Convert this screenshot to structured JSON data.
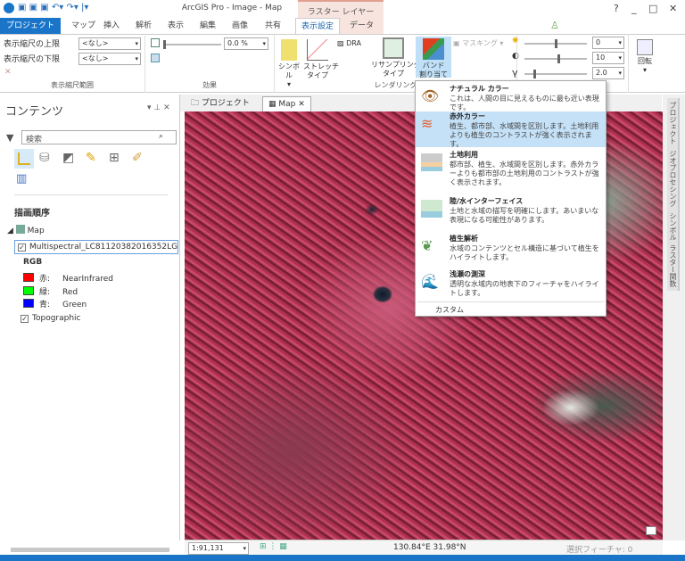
{
  "window": {
    "title": "ArcGIS Pro - Image - Map",
    "contextual_tab": "ラスター レイヤー",
    "help": "?",
    "minimize": "_",
    "maximize": "□",
    "close": "✕"
  },
  "tabs": [
    {
      "label": "プロジェクト"
    },
    {
      "label": "マップ"
    },
    {
      "label": "挿入"
    },
    {
      "label": "解析"
    },
    {
      "label": "表示"
    },
    {
      "label": "編集"
    },
    {
      "label": "画像"
    },
    {
      "label": "共有"
    },
    {
      "label": "表示設定",
      "active": true
    },
    {
      "label": "データ"
    }
  ],
  "ribbon": {
    "scale_range": {
      "max_label": "表示縮尺の上限",
      "min_label": "表示縮尺の下限",
      "max_value": "<なし>",
      "min_value": "<なし>",
      "group": "表示縮尺範囲"
    },
    "effects": {
      "transparency": "0.0 %",
      "group": "効果"
    },
    "rendering": {
      "symbology": "シンボル",
      "stretch": "ストレッチ\nタイプ",
      "dra": "DRA",
      "resampling": "リサンプリング\nタイプ",
      "band": "バンド\n割り当て",
      "masking": "マスキング",
      "group": "レンダリング"
    },
    "enhance": {
      "brightness": "0",
      "contrast": "10",
      "gamma": "2.0"
    },
    "rotate": "回転"
  },
  "contents": {
    "title": "コンテンツ",
    "search_placeholder": "検索",
    "section": "描画順序",
    "map": "Map",
    "layer": "Multispectral_LC81120382016352LGN00",
    "rgb": "RGB",
    "bands": [
      {
        "label": "赤:",
        "value": "NearInfrared",
        "color": "#ff0000"
      },
      {
        "label": "緑:",
        "value": "Red",
        "color": "#00ff00"
      },
      {
        "label": "青:",
        "value": "Green",
        "color": "#0000ff"
      }
    ],
    "basemap": "Topographic"
  },
  "view_tabs": [
    {
      "label": "プロジェクト"
    },
    {
      "label": "Map",
      "active": true
    }
  ],
  "side_tabs": [
    "プロジェクト",
    "ジオプロセシング",
    "シンボル",
    "ラスター関数"
  ],
  "status": {
    "scale": "1:91,131",
    "coords": "130.84°E 31.98°N",
    "selected": "選択フィーチャ: 0"
  },
  "band_menu": [
    {
      "title": "ナチュラル カラー",
      "desc": "これは、人間の目に見えるものに最も近い表現です。",
      "icon": "eye-icon"
    },
    {
      "title": "赤外カラー",
      "desc": "植生、都市部、水域間を区別します。土地利用よりも植生のコントラストが強く表示されます。",
      "icon": "heat-icon",
      "highlight": true
    },
    {
      "title": "土地利用",
      "desc": "都市部、植生、水域間を区別します。赤外カラーよりも都市部の土地利用のコントラストが強く表示されます。",
      "icon": "city-icon"
    },
    {
      "title": "陸/水インターフェイス",
      "desc": "土地と水域の描写を明確にします。あいまいな表現になる可能性があります。",
      "icon": "mountain-water-icon"
    },
    {
      "title": "植生解析",
      "desc": "水域のコンテンツとセル構造に基づいて植生をハイライトします。",
      "icon": "leaf-icon"
    },
    {
      "title": "浅瀬の測深",
      "desc": "透明な水域内の地表下のフィーチャをハイライトします。",
      "icon": "wave-icon"
    }
  ],
  "band_menu_custom": "カスタム"
}
